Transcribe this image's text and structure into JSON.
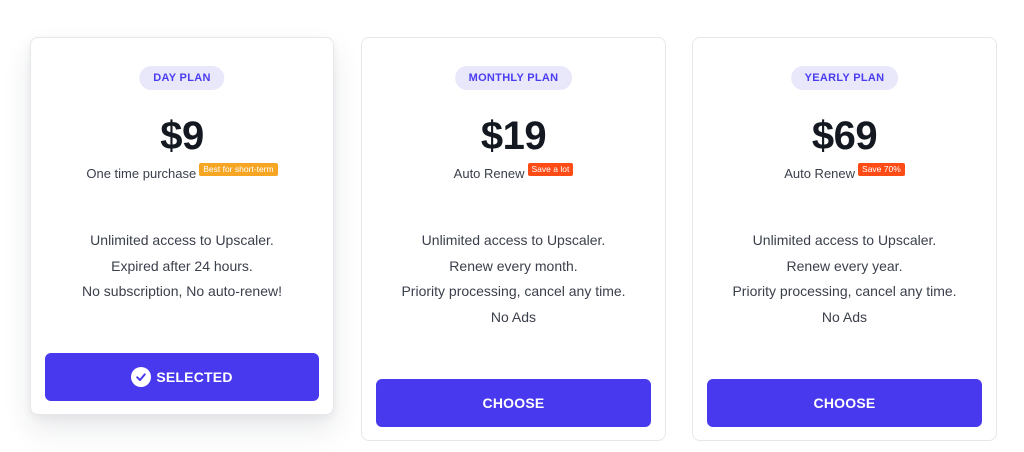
{
  "plans": [
    {
      "pill": "DAY PLAN",
      "price": "$9",
      "sub": "One time purchase",
      "tag": "Best for short-term",
      "features": [
        "Unlimited access to Upscaler.",
        "Expired after 24 hours.",
        "No subscription, No auto-renew!"
      ],
      "button": "SELECTED",
      "selected": true
    },
    {
      "pill": "MONTHLY PLAN",
      "price": "$19",
      "sub": "Auto Renew",
      "tag": "Save a lot",
      "features": [
        "Unlimited access to Upscaler.",
        "Renew every month.",
        "Priority processing, cancel any time.",
        "No Ads"
      ],
      "button": "CHOOSE",
      "selected": false
    },
    {
      "pill": "YEARLY PLAN",
      "price": "$69",
      "sub": "Auto Renew",
      "tag": "Save 70%",
      "features": [
        "Unlimited access to Upscaler.",
        "Renew every year.",
        "Priority processing, cancel any time.",
        "No Ads"
      ],
      "button": "CHOOSE",
      "selected": false
    }
  ],
  "colors": {
    "accent": "#4838ee",
    "pill_bg": "#e9e8fb",
    "tag_yellow": "#f6a623",
    "tag_red": "#ff4b16"
  },
  "icons": {
    "selected": "check-circle-icon"
  }
}
